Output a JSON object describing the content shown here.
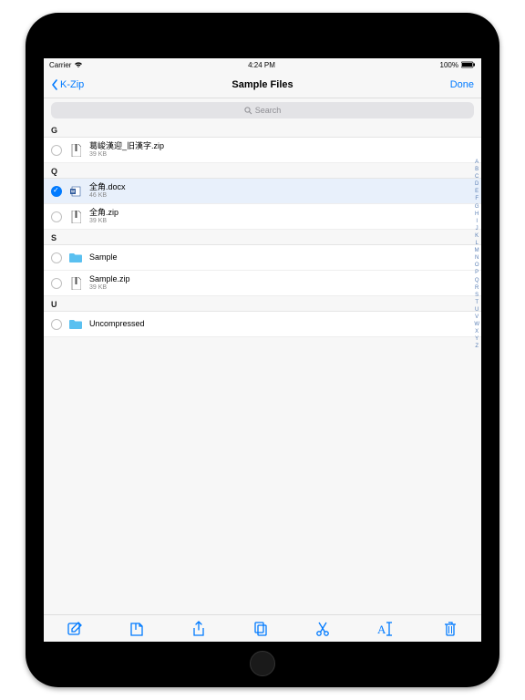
{
  "status": {
    "carrier": "Carrier",
    "time": "4:24 PM",
    "battery": "100%"
  },
  "nav": {
    "back": "K-Zip",
    "title": "Sample Files",
    "done": "Done"
  },
  "search": {
    "placeholder": "Search"
  },
  "index_letters": [
    "A",
    "B",
    "C",
    "D",
    "E",
    "F",
    "G",
    "H",
    "I",
    "J",
    "K",
    "L",
    "M",
    "N",
    "O",
    "P",
    "Q",
    "R",
    "S",
    "T",
    "U",
    "V",
    "W",
    "X",
    "Y",
    "Z"
  ],
  "sections": {
    "G": [
      {
        "name": "葛󠄀峻漢迎_旧漢字.zip",
        "size": "39 KB",
        "type": "zip"
      }
    ],
    "Q": [
      {
        "name": "全角.docx",
        "size": "46 KB",
        "type": "docx",
        "selected": true
      },
      {
        "name": "全角.zip",
        "size": "39 KB",
        "type": "zip"
      }
    ],
    "S": [
      {
        "name": "Sample",
        "type": "folder"
      },
      {
        "name": "Sample.zip",
        "size": "39 KB",
        "type": "zip"
      }
    ],
    "U": [
      {
        "name": "Uncompressed",
        "type": "folder"
      }
    ]
  },
  "section_headers": {
    "G": "G",
    "Q": "Q",
    "S": "S",
    "U": "U"
  },
  "toolbar": {
    "compose": "compose",
    "archive": "archive",
    "share": "share",
    "copy": "copy",
    "cut": "cut",
    "rename": "rename",
    "trash": "trash"
  }
}
